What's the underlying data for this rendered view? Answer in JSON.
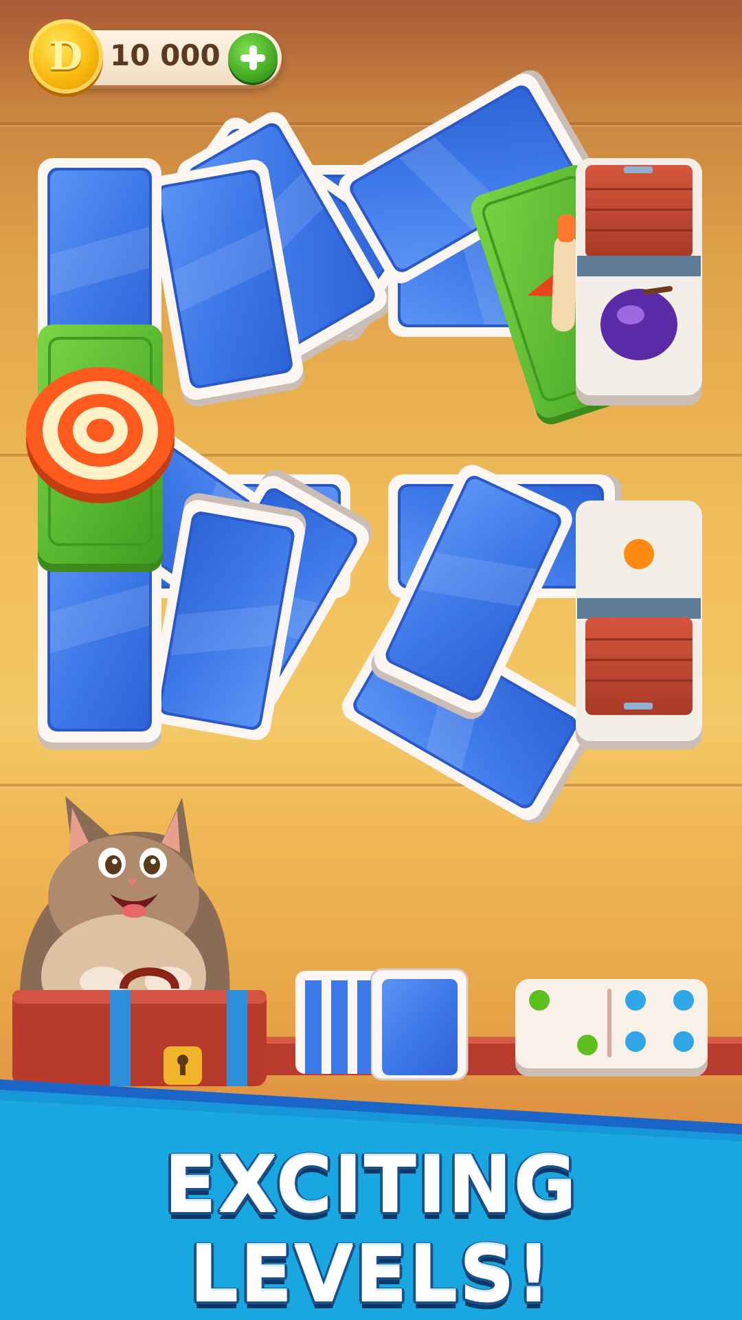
{
  "balance": {
    "coin_symbol": "D",
    "amount": "10 000",
    "icons": {
      "coin": "coin-icon",
      "add": "plus-icon"
    }
  },
  "board": {
    "tile_colors": {
      "blue": "#3d78e8",
      "green": "#4fb52a",
      "white": "#f4eee8",
      "red": "#c6452f"
    }
  },
  "items": {
    "target": "target-icon",
    "airplane": "airplane-icon",
    "plum": "plum-icon",
    "cat": "cat-mascot",
    "suitcase": "suitcase-icon"
  },
  "banner": {
    "line1": "EXCITING",
    "line2": "LEVELS!"
  }
}
